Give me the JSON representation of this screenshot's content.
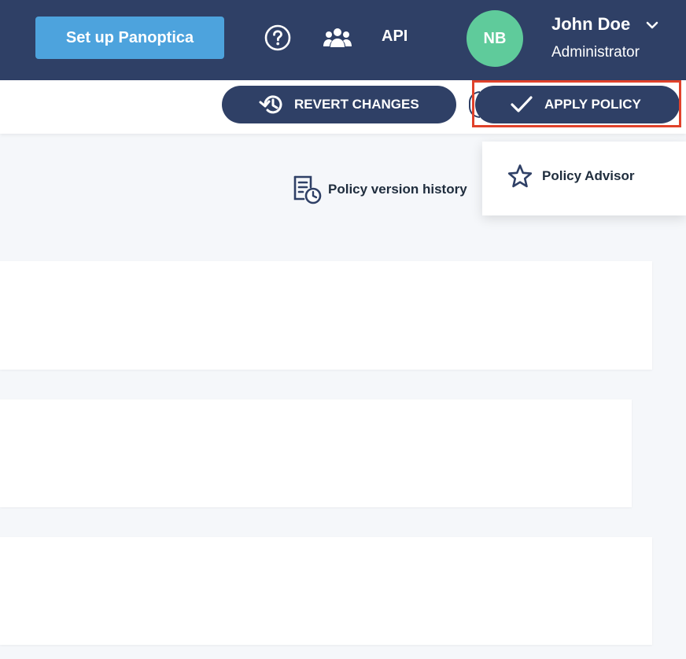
{
  "topbar": {
    "setup_label": "Set up Panoptica",
    "help_icon": "question-circle-icon",
    "team_icon": "users-icon",
    "api_label": "API",
    "avatar_initials": "NB",
    "user_name": "John Doe",
    "user_role": "Administrator",
    "colors": {
      "background": "#2f4066",
      "setup_button": "#4da3dd",
      "avatar": "#5fcb9b"
    }
  },
  "actions": {
    "revert_label": "REVERT CHANGES",
    "revert_icon": "history-icon",
    "apply_label": "APPLY POLICY",
    "apply_icon": "checkmark-icon",
    "highlight_color": "#e0422b"
  },
  "toolbar": {
    "history_label": "Policy version history",
    "history_icon": "document-clock-icon"
  },
  "menu": {
    "items": [
      {
        "label": "Policy Advisor",
        "icon": "star-icon"
      }
    ]
  }
}
